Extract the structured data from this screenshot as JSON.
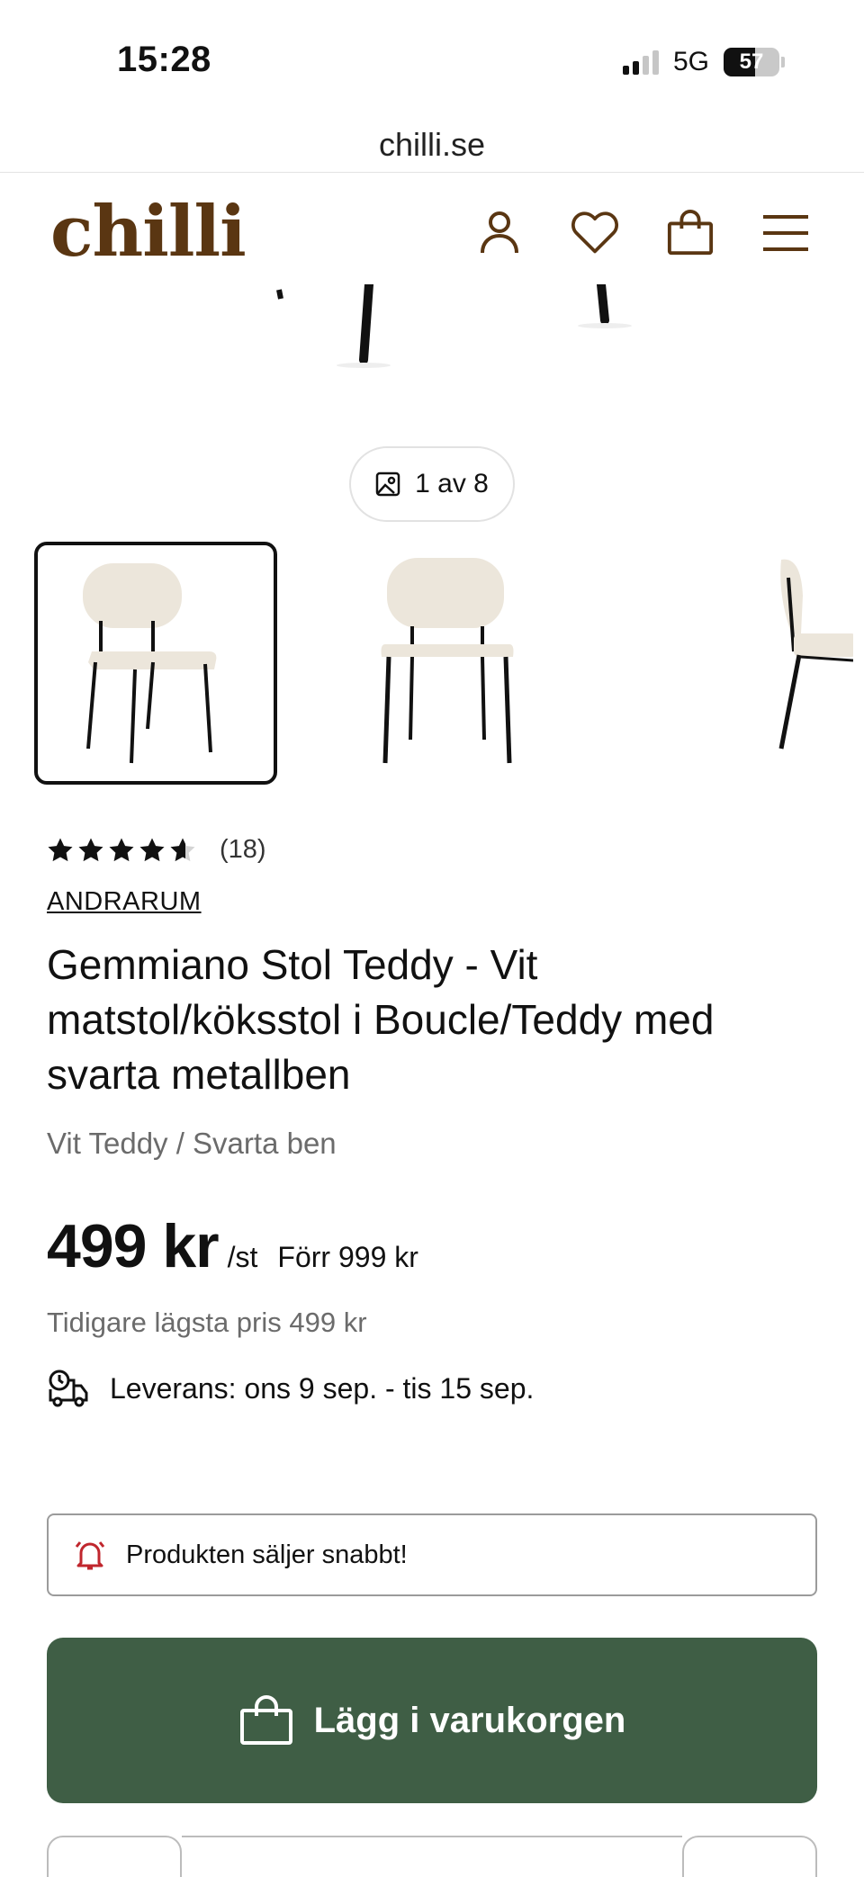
{
  "status_bar": {
    "time": "15:28",
    "network": "5G",
    "battery_percent": "57"
  },
  "browser": {
    "url": "chilli.se"
  },
  "header": {
    "logo": "chilli",
    "icons": [
      "user-icon",
      "heart-icon",
      "shopping-bag-icon",
      "menu-icon"
    ]
  },
  "gallery": {
    "counter": "1 av 8",
    "thumbnails": [
      "chair-thumbnail-1",
      "chair-thumbnail-2",
      "chair-thumbnail-3"
    ],
    "active_index": 0
  },
  "product": {
    "rating_value": 4.6,
    "rating_count": "(18)",
    "brand": "ANDRARUM",
    "title": "Gemmiano Stol Teddy - Vit matstol/köksstol i Boucle/Teddy med svarta metallben",
    "variant": "Vit Teddy / Svarta ben",
    "price": "499 kr",
    "price_unit": "/st",
    "previous_price": "Förr 999 kr",
    "lowest_price": "Tidigare lägsta pris 499 kr",
    "delivery": "Leverans: ons 9 sep. - tis 15 sep."
  },
  "alert": {
    "text": "Produkten säljer snabbt!"
  },
  "actions": {
    "add_to_cart": "Lägg i varukorgen"
  },
  "colors": {
    "brand": "#5a3612",
    "cart_button": "#3f5e45",
    "alert_icon": "#c0262d"
  }
}
